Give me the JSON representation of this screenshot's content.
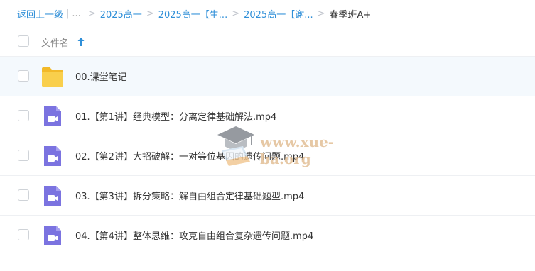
{
  "breadcrumb": {
    "back": "返回上一级",
    "dots": "...",
    "items": [
      "2025高一",
      "2025高一【生...",
      "2025高一【谢..."
    ],
    "current": "春季班A+"
  },
  "list_header": {
    "name_label": "文件名"
  },
  "files": [
    {
      "name": "00.课堂笔记",
      "type": "folder"
    },
    {
      "name": "01.【第1讲】经典模型：分离定律基础解法.mp4",
      "type": "video"
    },
    {
      "name": "02.【第2讲】大招破解：一对等位基因的遗传问题.mp4",
      "type": "video"
    },
    {
      "name": "03.【第3讲】拆分策略：解自由组合定律基础题型.mp4",
      "type": "video"
    },
    {
      "name": "04.【第4讲】整体思维：攻克自由组合复杂遗传问题.mp4",
      "type": "video"
    }
  ],
  "watermark": {
    "text": "www.xue-ba.org"
  },
  "colors": {
    "link": "#2f8fd8",
    "folder": "#f7c843",
    "video": "#7b73e0",
    "highlight": "#f4f9fd",
    "sort": "#2f8fd8"
  }
}
